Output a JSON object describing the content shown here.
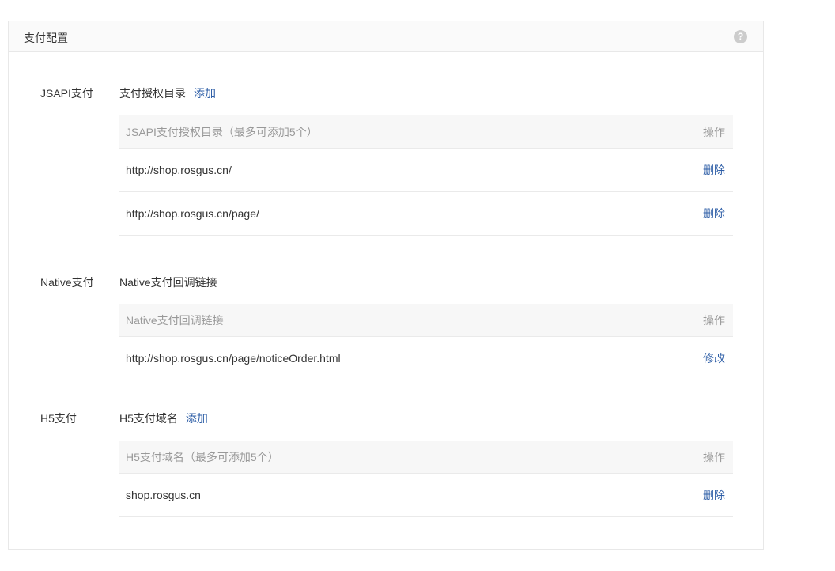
{
  "panel": {
    "title": "支付配置"
  },
  "jsapi": {
    "label": "JSAPI支付",
    "sub_label": "支付授权目录",
    "add_label": "添加",
    "table": {
      "col_main": "JSAPI支付授权目录（最多可添加5个）",
      "col_action": "操作",
      "rows": [
        {
          "value": "http://shop.rosgus.cn/",
          "action": "删除"
        },
        {
          "value": "http://shop.rosgus.cn/page/",
          "action": "删除"
        }
      ]
    }
  },
  "native": {
    "label": "Native支付",
    "sub_label": "Native支付回调链接",
    "table": {
      "col_main": "Native支付回调链接",
      "col_action": "操作",
      "rows": [
        {
          "value": "http://shop.rosgus.cn/page/noticeOrder.html",
          "action": "修改"
        }
      ]
    }
  },
  "h5": {
    "label": "H5支付",
    "sub_label": "H5支付域名",
    "add_label": "添加",
    "table": {
      "col_main": "H5支付域名（最多可添加5个）",
      "col_action": "操作",
      "rows": [
        {
          "value": "shop.rosgus.cn",
          "action": "删除"
        }
      ]
    }
  },
  "help_icon": {
    "glyph": "?",
    "icon": "question-circle-icon"
  }
}
